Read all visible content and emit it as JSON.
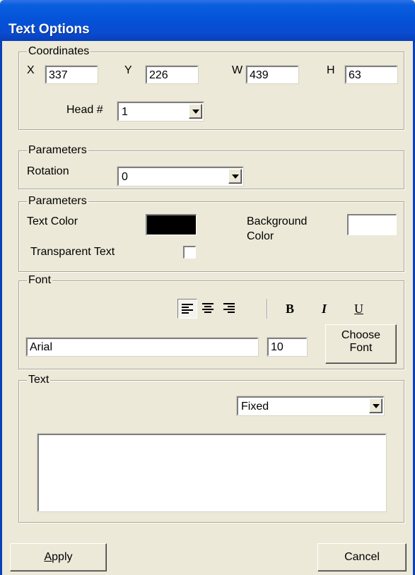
{
  "window": {
    "title": "Text Options"
  },
  "coordinates": {
    "legend": "Coordinates",
    "x_label": "X",
    "x_value": "337",
    "y_label": "Y",
    "y_value": "226",
    "w_label": "W",
    "w_value": "439",
    "h_label": "H",
    "h_value": "63",
    "head_label": "Head #",
    "head_value": "1"
  },
  "parameters1": {
    "legend": "Parameters",
    "rotation_label": "Rotation",
    "rotation_value": "0"
  },
  "parameters2": {
    "legend": "Parameters",
    "text_color_label": "Text Color",
    "text_color": "#000000",
    "background_color_label_line1": "Background",
    "background_color_label_line2": "Color",
    "background_color": "#ffffff",
    "transparent_label": "Transparent Text",
    "transparent_checked": false
  },
  "font": {
    "legend": "Font",
    "bold_label": "B",
    "italic_label": "I",
    "underline_label": "U",
    "align_selected": "left",
    "font_name": "Arial",
    "font_size": "10",
    "choose_line1": "Choose",
    "choose_line2": "Font"
  },
  "text": {
    "legend": "Text",
    "mode_value": "Fixed",
    "content": ""
  },
  "footer": {
    "apply_mnemonic": "A",
    "apply_rest": "pply",
    "cancel_label": "Cancel"
  }
}
